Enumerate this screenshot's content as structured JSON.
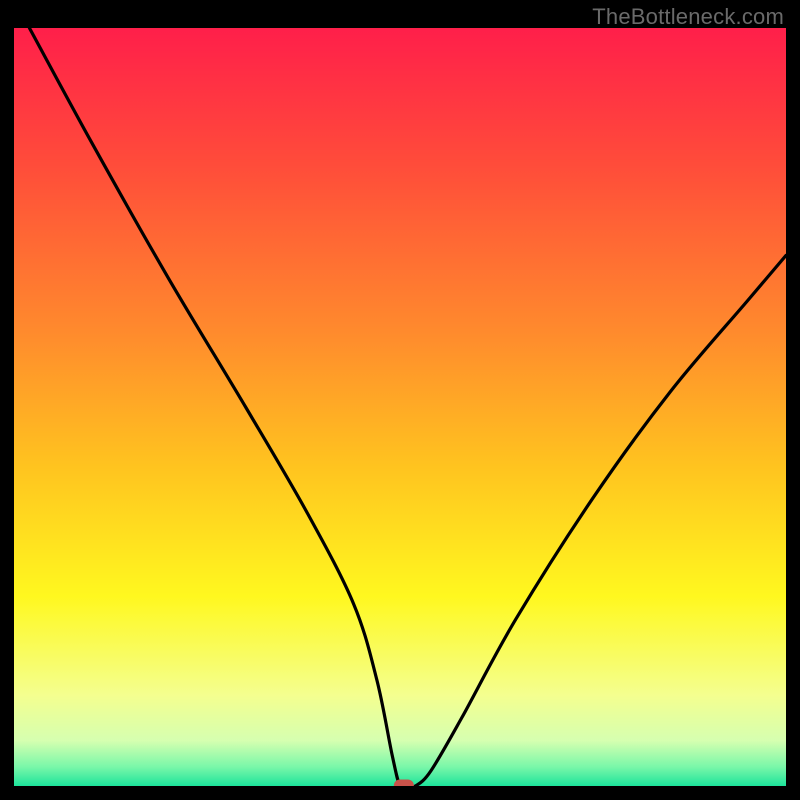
{
  "watermark": "TheBottleneck.com",
  "chart_data": {
    "type": "line",
    "title": "",
    "xlabel": "",
    "ylabel": "",
    "xlim": [
      0,
      100
    ],
    "ylim": [
      0,
      100
    ],
    "grid": false,
    "series": [
      {
        "name": "bottleneck-curve",
        "x": [
          2,
          10,
          20,
          30,
          38,
          44,
          47,
          49,
          50,
          51,
          52,
          54,
          58,
          65,
          75,
          85,
          95,
          100
        ],
        "y": [
          100,
          85,
          67,
          50,
          36,
          24,
          14,
          4,
          0,
          0,
          0,
          2,
          9,
          22,
          38,
          52,
          64,
          70
        ]
      }
    ],
    "marker": {
      "x": 50.5,
      "y": 0
    },
    "gradient_stops": [
      {
        "offset": 0.0,
        "color": "#ff1f4a"
      },
      {
        "offset": 0.18,
        "color": "#ff4c3a"
      },
      {
        "offset": 0.4,
        "color": "#ff8a2d"
      },
      {
        "offset": 0.58,
        "color": "#ffc41f"
      },
      {
        "offset": 0.75,
        "color": "#fff81f"
      },
      {
        "offset": 0.88,
        "color": "#f4ff8f"
      },
      {
        "offset": 0.94,
        "color": "#d6ffb0"
      },
      {
        "offset": 0.975,
        "color": "#79f7a9"
      },
      {
        "offset": 1.0,
        "color": "#1de39b"
      }
    ]
  }
}
